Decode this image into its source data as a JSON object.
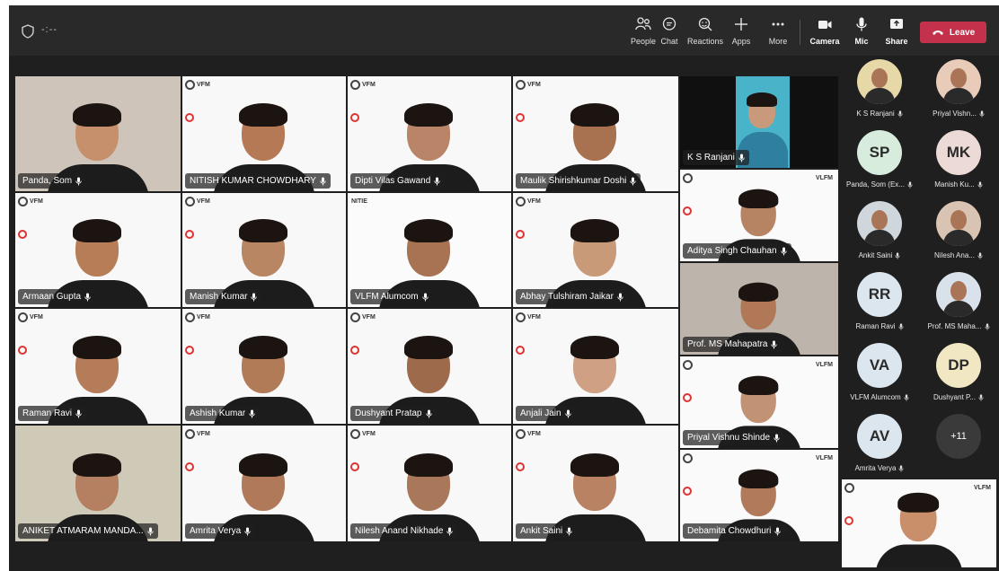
{
  "topbar": {
    "timer": "-:--",
    "buttons": [
      {
        "id": "people",
        "label": "People",
        "icon": "people-icon"
      },
      {
        "id": "chat",
        "label": "Chat",
        "icon": "chat-icon"
      },
      {
        "id": "reactions",
        "label": "Reactions",
        "icon": "reactions-icon"
      },
      {
        "id": "apps",
        "label": "Apps",
        "icon": "plus-icon"
      },
      {
        "id": "more",
        "label": "More",
        "icon": "more-icon"
      },
      {
        "id": "camera",
        "label": "Camera",
        "icon": "camera-icon"
      },
      {
        "id": "mic",
        "label": "Mic",
        "icon": "mic-icon"
      },
      {
        "id": "share",
        "label": "Share",
        "icon": "share-icon"
      }
    ],
    "leave_label": "Leave"
  },
  "tiles": [
    {
      "name": "Panda, Som"
    },
    {
      "name": "NITISH KUMAR CHOWDHARY"
    },
    {
      "name": "Dipti Vilas Gawand"
    },
    {
      "name": "Maulik Shirishkumar Doshi"
    },
    {
      "name": "K S Ranjani"
    },
    {
      "name": "Armaan Gupta"
    },
    {
      "name": "Manish Kumar"
    },
    {
      "name": "VLFM Alumcom"
    },
    {
      "name": "Abhay Tulshiram Jaikar"
    },
    {
      "name": "Aditya Singh Chauhan"
    },
    {
      "name": "Raman Ravi"
    },
    {
      "name": "Ashish Kumar"
    },
    {
      "name": "Dushyant Pratap"
    },
    {
      "name": "Anjali Jain"
    },
    {
      "name": "Prof. MS Mahapatra"
    },
    {
      "name": "ANIKET ATMARAM MANDA..."
    },
    {
      "name": "Amrita Verya"
    },
    {
      "name": "Nilesh Anand Nikhade"
    },
    {
      "name": "Ankit Saini"
    },
    {
      "name": "Priyal Vishnu Shinde"
    },
    {
      "name": "Debamita Chowdhuri"
    }
  ],
  "tile_logo_text": {
    "vfm": "VFM",
    "nitie": "NITIE",
    "vlfm": "VLFM"
  },
  "panel": [
    {
      "name": "K S Ranjani",
      "initials": "",
      "color": "#e7d8a8"
    },
    {
      "name": "Priyal Vishn...",
      "initials": "",
      "color": "#e8cbb8"
    },
    {
      "name": "Panda, Som (Ex...",
      "initials": "SP",
      "color": "#d7ecdc"
    },
    {
      "name": "Manish Ku...",
      "initials": "MK",
      "color": "#ecdad6"
    },
    {
      "name": "Ankit Saini",
      "initials": "",
      "color": "#cfd6dc"
    },
    {
      "name": "Nilesh Ana...",
      "initials": "",
      "color": "#d9c4b3"
    },
    {
      "name": "Raman Ravi",
      "initials": "RR",
      "color": "#dce6ef"
    },
    {
      "name": "Prof. MS Maha...",
      "initials": "",
      "color": "#d9e2ea"
    },
    {
      "name": "VLFM Alumcom",
      "initials": "VA",
      "color": "#dce6ef"
    },
    {
      "name": "Dushyant P...",
      "initials": "DP",
      "color": "#f1e7c2"
    },
    {
      "name": "Amrita Verya",
      "initials": "AV",
      "color": "#dce6ef"
    }
  ],
  "overflow_count": "+11",
  "colors": {
    "leave": "#c4314b",
    "topbar": "#292929",
    "stage": "#1f1f1f"
  }
}
